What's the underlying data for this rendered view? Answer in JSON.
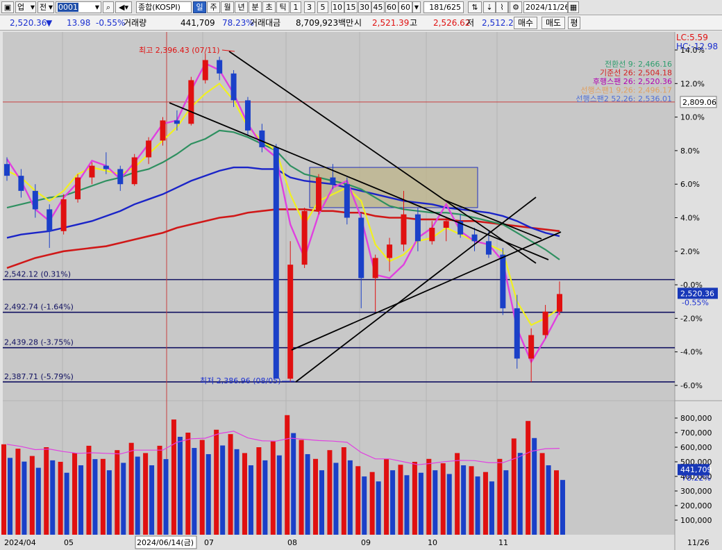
{
  "toolbar": {
    "market": "업",
    "prev": "전",
    "code": "0001",
    "index_name": "종합(KOSPI)",
    "periods": [
      "일",
      "주",
      "월",
      "년",
      "분",
      "초",
      "틱"
    ],
    "minutes": [
      "1",
      "3",
      "5",
      "10",
      "15",
      "30",
      "45",
      "60"
    ],
    "custom_minute": "60",
    "count": "181/625",
    "date": "2024/11/26"
  },
  "quote": {
    "price": "2,520.36",
    "arrow": "▼",
    "change": "13.98",
    "change_pct": "-0.55%",
    "volume_label": "거래량",
    "volume": "441,709",
    "volume_ratio": "78.23%",
    "amount_label": "거래대금",
    "amount": "8,709,923백만",
    "open_label": "시",
    "open": "2,521.39",
    "high_label": "고",
    "high": "2,526.62",
    "low_label": "저",
    "low": "2,512.2",
    "buy_btn": "매수",
    "sell_btn": "매도",
    "avg_btn": "평"
  },
  "colors": {
    "up": "#e01010",
    "down": "#1a40c8",
    "chart_bg": "#c8c8c8",
    "panel_bg": "#e0e0e0"
  },
  "chart_data": {
    "type": "candlestick",
    "price_axis": {
      "unit": "% from base",
      "ticks": [
        "14.0%",
        "12.0%",
        "10.0%",
        "8.0%",
        "6.0%",
        "4.0%",
        "2.0%",
        "-0.0%",
        "-2.0%",
        "-4.0%",
        "-6.0%"
      ],
      "ylim_pct": [
        -6.5,
        14.2
      ]
    },
    "volume_axis": {
      "ticks": [
        "800,000",
        "700,000",
        "600,000",
        "500,000",
        "400,000",
        "300,000",
        "200,000",
        "100,000"
      ],
      "ylim": [
        0,
        900000
      ]
    },
    "x_labels": [
      "2024/04",
      "05",
      "07",
      "08",
      "09",
      "10",
      "11"
    ],
    "cursor_date": "2024/06/14(금)",
    "right_date": "11/26",
    "legend": {
      "lc": "LC:5.59",
      "hc": "HC:-12.98",
      "ichimoku": [
        {
          "text": "전환선 9: 2,466.16",
          "color": "#2e9e6e"
        },
        {
          "text": "기준선 26: 2,504.18",
          "color": "#d42020"
        },
        {
          "text": "후행스팬 26: 2,520.36",
          "color": "#b000b0"
        },
        {
          "text": "선행스팬1 9,26: 2,496.17",
          "color": "#e0a060"
        },
        {
          "text": "선행스팬2 52,26: 2,536.01",
          "color": "#4d6fd8"
        }
      ]
    },
    "high_marker": "최고 2,396.43 (07/11)",
    "low_marker": "최저 2,386.96 (08/05)",
    "support_lines": [
      {
        "label": "2,542.12 (0.31%)",
        "pct": 0.31
      },
      {
        "label": "2,492.74 (-1.64%)",
        "pct": -1.64
      },
      {
        "label": "2,439.28 (-3.75%)",
        "pct": -3.75
      },
      {
        "label": "2,387.71 (-5.79%)",
        "pct": -5.79
      }
    ],
    "ref_line": {
      "value": "2,809.06",
      "pct": 10.9
    },
    "current_price": {
      "value": "2,520.36",
      "change_pct": "-0.55%",
      "pct": -0.55
    },
    "current_volume": {
      "value": "441,709",
      "ratio": "78.22%",
      "volume": 441709
    },
    "box_zone": {
      "x_from": "2024/08/13",
      "x_to": "2024/09/30",
      "pct_from": 4.6,
      "pct_to": 7.0
    },
    "moving_average_pct": {
      "ma5": [
        7.5,
        6.2,
        4.5,
        3.8,
        5.2,
        6.1,
        7.4,
        7.1,
        6.3,
        7.3,
        8.4,
        9.6,
        9.8,
        11.6,
        13.2,
        12.8,
        11.4,
        9.6,
        8.3,
        7.6,
        3.6,
        1.6,
        4.2,
        5.8,
        6.2,
        4.0,
        0.6,
        0.4,
        1.2,
        2.8,
        3.4,
        4.8,
        3.2,
        2.6,
        2.4,
        1.4,
        -2.6,
        -4.6,
        -3.2,
        -1.6
      ],
      "ma20": [
        6.8,
        6.4,
        5.6,
        5.0,
        5.6,
        6.6,
        7.0,
        6.8,
        6.6,
        7.0,
        7.8,
        8.6,
        9.4,
        10.6,
        11.4,
        12.0,
        11.0,
        9.4,
        8.6,
        8.0,
        5.4,
        3.6,
        5.0,
        5.4,
        5.8,
        5.0,
        2.4,
        1.4,
        1.8,
        2.6,
        2.8,
        3.4,
        3.0,
        2.6,
        2.4,
        2.0,
        -1.0,
        -2.4,
        -2.0,
        -1.4
      ],
      "ma60": [
        4.6,
        4.8,
        5.0,
        5.2,
        5.3,
        5.6,
        5.9,
        6.2,
        6.4,
        6.7,
        6.9,
        7.3,
        7.8,
        8.4,
        8.7,
        9.2,
        9.1,
        8.8,
        8.4,
        8.0,
        7.1,
        6.6,
        6.4,
        6.2,
        6.0,
        5.7,
        5.2,
        4.7,
        4.5,
        4.4,
        4.3,
        4.3,
        4.2,
        4.0,
        3.8,
        3.6,
        3.1,
        2.6,
        2.1,
        1.5
      ],
      "ma120": [
        2.8,
        3.0,
        3.1,
        3.2,
        3.4,
        3.6,
        3.8,
        4.1,
        4.4,
        4.8,
        5.1,
        5.4,
        5.8,
        6.2,
        6.5,
        6.8,
        7.0,
        7.0,
        6.9,
        6.9,
        6.4,
        6.2,
        6.1,
        6.0,
        5.8,
        5.6,
        5.4,
        5.2,
        5.0,
        4.9,
        4.8,
        4.6,
        4.5,
        4.4,
        4.3,
        4.1,
        3.8,
        3.4,
        3.1,
        2.9
      ],
      "ma240": [
        1.0,
        1.3,
        1.6,
        1.8,
        2.0,
        2.1,
        2.2,
        2.3,
        2.5,
        2.7,
        2.9,
        3.1,
        3.4,
        3.6,
        3.8,
        4.0,
        4.1,
        4.3,
        4.4,
        4.5,
        4.5,
        4.5,
        4.4,
        4.4,
        4.3,
        4.3,
        4.1,
        4.0,
        4.0,
        3.9,
        3.9,
        3.9,
        3.8,
        3.8,
        3.7,
        3.6,
        3.5,
        3.4,
        3.3,
        3.2
      ]
    },
    "candles_pct": [
      [
        7.2,
        7.6,
        6.2,
        6.5
      ],
      [
        6.5,
        6.9,
        5.2,
        5.6
      ],
      [
        5.6,
        6.0,
        4.0,
        4.5
      ],
      [
        4.5,
        4.8,
        2.2,
        3.2
      ],
      [
        3.2,
        5.4,
        3.0,
        5.1
      ],
      [
        5.1,
        6.6,
        4.9,
        6.4
      ],
      [
        6.4,
        7.3,
        6.0,
        7.1
      ],
      [
        7.1,
        7.9,
        6.6,
        6.9
      ],
      [
        6.9,
        7.1,
        5.6,
        6.0
      ],
      [
        6.0,
        7.8,
        5.9,
        7.6
      ],
      [
        7.6,
        8.8,
        7.2,
        8.6
      ],
      [
        8.6,
        10.0,
        8.3,
        9.8
      ],
      [
        9.8,
        10.4,
        9.2,
        9.6
      ],
      [
        9.6,
        12.4,
        9.5,
        12.2
      ],
      [
        12.2,
        13.8,
        12.0,
        13.4
      ],
      [
        13.4,
        13.6,
        12.2,
        12.6
      ],
      [
        12.6,
        12.8,
        10.6,
        11.0
      ],
      [
        11.0,
        11.2,
        8.9,
        9.2
      ],
      [
        9.2,
        9.6,
        7.9,
        8.2
      ],
      [
        8.2,
        8.4,
        -2.5,
        -5.6
      ],
      [
        -5.6,
        2.6,
        -5.8,
        1.2
      ],
      [
        1.2,
        4.6,
        1.0,
        4.4
      ],
      [
        4.4,
        6.6,
        4.2,
        6.4
      ],
      [
        6.4,
        7.2,
        5.7,
        6.0
      ],
      [
        6.0,
        6.4,
        3.6,
        4.0
      ],
      [
        4.0,
        4.3,
        -1.4,
        0.4
      ],
      [
        0.4,
        1.8,
        -1.6,
        1.6
      ],
      [
        1.6,
        2.8,
        0.8,
        2.4
      ],
      [
        2.4,
        5.6,
        2.0,
        4.2
      ],
      [
        4.2,
        4.6,
        2.0,
        2.6
      ],
      [
        2.6,
        3.8,
        2.4,
        3.4
      ],
      [
        3.4,
        4.0,
        2.6,
        3.8
      ],
      [
        3.8,
        4.2,
        2.8,
        3.0
      ],
      [
        3.0,
        3.4,
        2.0,
        2.6
      ],
      [
        2.6,
        3.2,
        1.6,
        1.8
      ],
      [
        1.8,
        2.2,
        -1.8,
        -1.4
      ],
      [
        -1.4,
        -0.6,
        -5.0,
        -4.4
      ],
      [
        -4.4,
        -2.6,
        -5.8,
        -3.0
      ],
      [
        -3.0,
        -1.2,
        -3.2,
        -1.6
      ],
      [
        -1.6,
        0.2,
        -1.8,
        -0.55
      ]
    ],
    "volume": [
      620000,
      590000,
      540000,
      600000,
      500000,
      560000,
      610000,
      520000,
      580000,
      630000,
      560000,
      610000,
      790000,
      700000,
      650000,
      720000,
      690000,
      560000,
      600000,
      640000,
      820000,
      650000,
      520000,
      580000,
      600000,
      470000,
      430000,
      520000,
      480000,
      500000,
      520000,
      490000,
      560000,
      470000,
      430000,
      520000,
      660000,
      780000,
      560000,
      441709
    ]
  }
}
